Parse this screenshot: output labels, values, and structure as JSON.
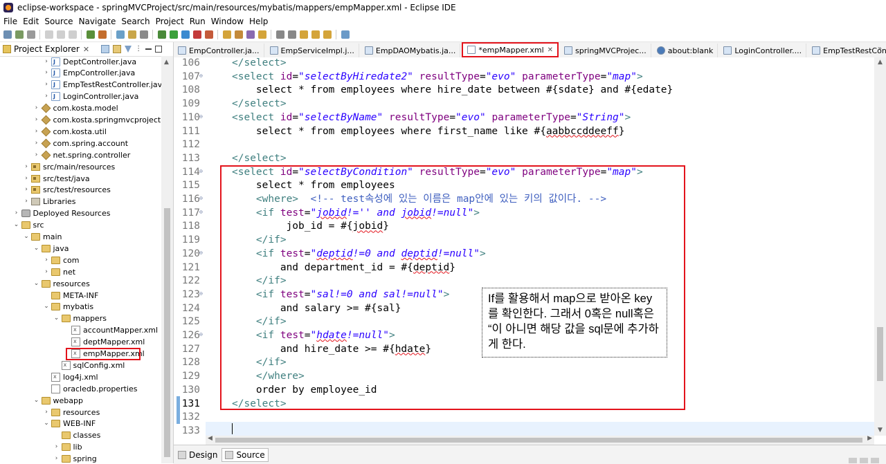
{
  "window": {
    "title": "eclipse-workspace - springMVCProject/src/main/resources/mybatis/mappers/empMapper.xml - Eclipse IDE"
  },
  "menu": [
    "File",
    "Edit",
    "Source",
    "Navigate",
    "Search",
    "Project",
    "Run",
    "Window",
    "Help"
  ],
  "project_explorer": {
    "title": "Project Explorer",
    "tree": [
      {
        "label": "DeptController.java",
        "indent": 4,
        "icon": "java",
        "twisty": ">"
      },
      {
        "label": "EmpController.java",
        "indent": 4,
        "icon": "java",
        "twisty": ">"
      },
      {
        "label": "EmpTestRestController.java",
        "indent": 4,
        "icon": "java",
        "twisty": ">"
      },
      {
        "label": "LoginController.java",
        "indent": 4,
        "icon": "java",
        "twisty": ">"
      },
      {
        "label": "com.kosta.model",
        "indent": 3,
        "icon": "pkg",
        "twisty": ">"
      },
      {
        "label": "com.kosta.springmvcproject",
        "indent": 3,
        "icon": "pkg",
        "twisty": ">"
      },
      {
        "label": "com.kosta.util",
        "indent": 3,
        "icon": "pkg",
        "twisty": ">"
      },
      {
        "label": "com.spring.account",
        "indent": 3,
        "icon": "pkg",
        "twisty": ">"
      },
      {
        "label": "net.spring.controller",
        "indent": 3,
        "icon": "pkg",
        "twisty": ">"
      },
      {
        "label": "src/main/resources",
        "indent": 2,
        "icon": "srcfolder",
        "twisty": ">"
      },
      {
        "label": "src/test/java",
        "indent": 2,
        "icon": "srcfolder",
        "twisty": ">"
      },
      {
        "label": "src/test/resources",
        "indent": 2,
        "icon": "srcfolder",
        "twisty": ">"
      },
      {
        "label": "Libraries",
        "indent": 2,
        "icon": "lib",
        "twisty": ">"
      },
      {
        "label": "Deployed Resources",
        "indent": 1,
        "icon": "deploy",
        "twisty": ">"
      },
      {
        "label": "src",
        "indent": 1,
        "icon": "folder",
        "twisty": "v"
      },
      {
        "label": "main",
        "indent": 2,
        "icon": "folder",
        "twisty": "v"
      },
      {
        "label": "java",
        "indent": 3,
        "icon": "folder",
        "twisty": "v"
      },
      {
        "label": "com",
        "indent": 4,
        "icon": "folder",
        "twisty": ">"
      },
      {
        "label": "net",
        "indent": 4,
        "icon": "folder",
        "twisty": ">"
      },
      {
        "label": "resources",
        "indent": 3,
        "icon": "folder",
        "twisty": "v"
      },
      {
        "label": "META-INF",
        "indent": 4,
        "icon": "folder",
        "twisty": ""
      },
      {
        "label": "mybatis",
        "indent": 4,
        "icon": "folder",
        "twisty": "v"
      },
      {
        "label": "mappers",
        "indent": 5,
        "icon": "folder",
        "twisty": "v"
      },
      {
        "label": "accountMapper.xml",
        "indent": 6,
        "icon": "xml",
        "twisty": ""
      },
      {
        "label": "deptMapper.xml",
        "indent": 6,
        "icon": "xml",
        "twisty": ""
      },
      {
        "label": "empMapper.xml",
        "indent": 6,
        "icon": "xml",
        "twisty": "",
        "highlight": true
      },
      {
        "label": "sqlConfig.xml",
        "indent": 5,
        "icon": "xml",
        "twisty": ""
      },
      {
        "label": "log4j.xml",
        "indent": 4,
        "icon": "xml",
        "twisty": ""
      },
      {
        "label": "oracledb.properties",
        "indent": 4,
        "icon": "props",
        "twisty": ""
      },
      {
        "label": "webapp",
        "indent": 3,
        "icon": "folder",
        "twisty": "v"
      },
      {
        "label": "resources",
        "indent": 4,
        "icon": "folder",
        "twisty": ">"
      },
      {
        "label": "WEB-INF",
        "indent": 4,
        "icon": "folder",
        "twisty": "v"
      },
      {
        "label": "classes",
        "indent": 5,
        "icon": "folder",
        "twisty": ""
      },
      {
        "label": "lib",
        "indent": 5,
        "icon": "folder",
        "twisty": ">"
      },
      {
        "label": "spring",
        "indent": 5,
        "icon": "folder",
        "twisty": ">"
      }
    ]
  },
  "editor_tabs": [
    {
      "label": "EmpController.ja...",
      "icon": "java"
    },
    {
      "label": "EmpServiceImpl.j...",
      "icon": "java"
    },
    {
      "label": "EmpDAOMybatis.ja...",
      "icon": "java"
    },
    {
      "label": "*empMapper.xml",
      "icon": "xml",
      "active": true
    },
    {
      "label": "springMVCProjec...",
      "icon": "java"
    },
    {
      "label": "about:blank",
      "icon": "globe"
    },
    {
      "label": "LoginController....",
      "icon": "java"
    },
    {
      "label": "EmpTestRestCon...",
      "icon": "java"
    }
  ],
  "code_lines": [
    {
      "n": "106",
      "fold": "",
      "html": "<span class='tag'>&lt;/select&gt;</span>"
    },
    {
      "n": "107",
      "fold": "⊖",
      "html": "<span class='tag'>&lt;select</span> <span class='attr'>id</span>=<span class='val'>\"selectByHiredate2\"</span> <span class='attr'>resultType</span>=<span class='val'>\"evo\"</span> <span class='attr'>parameterType</span>=<span class='val'>\"map\"</span><span class='tag'>&gt;</span>"
    },
    {
      "n": "108",
      "fold": "",
      "html": "    select * from employees where hire_date between #{sdate} and #{edate}"
    },
    {
      "n": "109",
      "fold": "",
      "html": "<span class='tag'>&lt;/select&gt;</span>"
    },
    {
      "n": "110",
      "fold": "⊖",
      "html": "<span class='tag'>&lt;select</span> <span class='attr'>id</span>=<span class='val'>\"selectByName\"</span> <span class='attr'>resultType</span>=<span class='val'>\"evo\"</span> <span class='attr'>parameterType</span>=<span class='val'>\"String\"</span><span class='tag'>&gt;</span>"
    },
    {
      "n": "111",
      "fold": "",
      "html": "    select * from employees where first_name like #{<span class='squig'>aabbccddeeff</span>}"
    },
    {
      "n": "112",
      "fold": "",
      "html": ""
    },
    {
      "n": "113",
      "fold": "",
      "html": "<span class='tag'>&lt;/select&gt;</span>"
    },
    {
      "n": "114",
      "fold": "⊖",
      "html": "<span class='tag'>&lt;select</span> <span class='attr'>id</span>=<span class='val'>\"selectByCondition\"</span> <span class='attr'>resultType</span>=<span class='val'>\"evo\"</span> <span class='attr'>parameterType</span>=<span class='val'>\"map\"</span><span class='tag'>&gt;</span>"
    },
    {
      "n": "115",
      "fold": "",
      "html": "    select * from employees"
    },
    {
      "n": "116",
      "fold": "⊖",
      "html": "    <span class='tag'>&lt;where&gt;</span>  <span class='cmt'>&lt;!-- test속성에 있는 이름은 map안에 있는 키의 값이다. --&gt;</span>"
    },
    {
      "n": "117",
      "fold": "⊖",
      "html": "    <span class='tag'>&lt;if</span> <span class='attr'>test</span>=<span class='val'>\"<span class='squig'>jobid</span>!='' and <span class='squig'>jobid</span>!=null\"</span><span class='tag'>&gt;</span>"
    },
    {
      "n": "118",
      "fold": "",
      "html": "         job_id = #{<span class='squig'>jobid</span>}"
    },
    {
      "n": "119",
      "fold": "",
      "html": "    <span class='tag'>&lt;/if&gt;</span>"
    },
    {
      "n": "120",
      "fold": "⊖",
      "html": "    <span class='tag'>&lt;if</span> <span class='attr'>test</span>=<span class='val'>\"<span class='squig'>deptid</span>!=0 and <span class='squig'>deptid</span>!=null\"</span><span class='tag'>&gt;</span>"
    },
    {
      "n": "121",
      "fold": "",
      "html": "        and department_id = #{<span class='squig'>deptid</span>}"
    },
    {
      "n": "122",
      "fold": "",
      "html": "    <span class='tag'>&lt;/if&gt;</span>"
    },
    {
      "n": "123",
      "fold": "⊖",
      "html": "    <span class='tag'>&lt;if</span> <span class='attr'>test</span>=<span class='val'>\"sal!=0 and sal!=null\"</span><span class='tag'>&gt;</span>"
    },
    {
      "n": "124",
      "fold": "",
      "html": "        and salary &gt;= #{sal}"
    },
    {
      "n": "125",
      "fold": "",
      "html": "    <span class='tag'>&lt;/if&gt;</span>"
    },
    {
      "n": "126",
      "fold": "⊖",
      "html": "    <span class='tag'>&lt;if</span> <span class='attr'>test</span>=<span class='val'>\"<span class='squig'>hdate</span>!=null\"</span><span class='tag'>&gt;</span>"
    },
    {
      "n": "127",
      "fold": "",
      "html": "        and hire_date &gt;= #{<span class='squig'>hdate</span>}"
    },
    {
      "n": "128",
      "fold": "",
      "html": "    <span class='tag'>&lt;/if&gt;</span>"
    },
    {
      "n": "129",
      "fold": "",
      "html": "    <span class='tag'>&lt;/where&gt;</span>"
    },
    {
      "n": "130",
      "fold": "",
      "html": "    order by employee_id"
    },
    {
      "n": "131",
      "fold": "",
      "html": "<span class='tag'>&lt;/select&gt;</span>"
    },
    {
      "n": "132",
      "fold": "",
      "html": ""
    },
    {
      "n": "133",
      "fold": "",
      "html": ""
    }
  ],
  "callout": {
    "text": "If를 활용해서 map으로 받아온 key를 확인한다. 그래서 0혹은 null혹은 “이 아니면 해당 값을 sql문에 추가하게 한다."
  },
  "bottom_tabs": [
    {
      "label": "Design"
    },
    {
      "label": "Source",
      "active": true
    }
  ]
}
